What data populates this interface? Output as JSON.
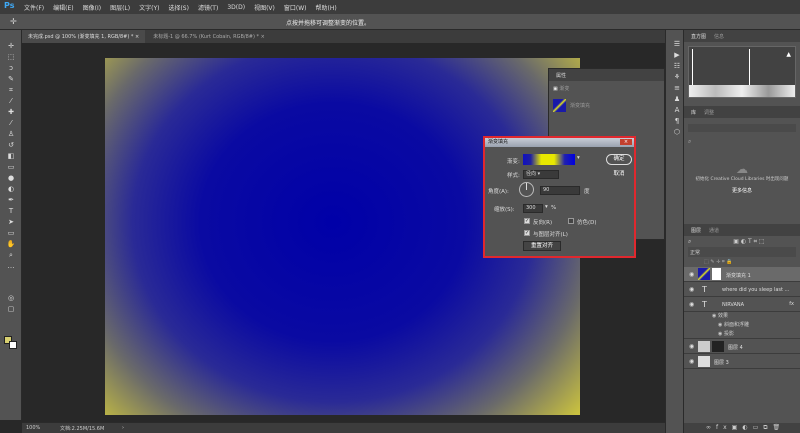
{
  "app": {
    "logo": "Ps",
    "menu": [
      "文件(F)",
      "编辑(E)",
      "图像(I)",
      "图层(L)",
      "文字(Y)",
      "选择(S)",
      "滤镜(T)",
      "3D(D)",
      "视图(V)",
      "窗口(W)",
      "帮助(H)"
    ]
  },
  "options": {
    "hint": "点按并拖移可调整渐变的位置。"
  },
  "tabs": [
    {
      "label": "未完成.psd @ 100% (渐变填充 1, RGB/8#) *",
      "close": "×"
    },
    {
      "label": "未标题-1 @ 66.7% (Kurt Cobain, RGB/8#) *",
      "close": "×"
    }
  ],
  "status": {
    "zoom": "100%",
    "doc": "文档:2.25M/15.6M"
  },
  "histogram": {
    "tabs": [
      "直方图",
      "信息"
    ]
  },
  "libraries": {
    "tabs": [
      "库",
      "调整"
    ],
    "message": "初始化 Creative Cloud Libraries 时出现问题",
    "more": "更多信息"
  },
  "properties": {
    "title": "属性",
    "subtitle": "渐变",
    "layer_label": "渐变填充"
  },
  "dialog": {
    "title": "渐变填充",
    "gradient_label": "渐变:",
    "style_label": "样式:",
    "style_value": "径向",
    "angle_label": "角度(A):",
    "angle_value": "90",
    "angle_unit": "度",
    "scale_label": "缩放(S):",
    "scale_value": "300",
    "scale_unit": "%",
    "reverse_label": "反向(R)",
    "reverse_checked": true,
    "dither_label": "仿色(D)",
    "dither_checked": false,
    "align_label": "与图层对齐(L)",
    "align_checked": true,
    "reset_label": "重置对齐",
    "ok": "确定",
    "cancel": "取消",
    "close": "×"
  },
  "layers": {
    "tabs": [
      "图层",
      "通道"
    ],
    "blend_mode": "正常",
    "items": [
      {
        "name": "渐变填充 1",
        "type": "fill",
        "selected": true
      },
      {
        "name": "where did you sleep last ...",
        "type": "text"
      },
      {
        "name": "NIRVANA",
        "type": "text",
        "fx": "fx"
      },
      {
        "name": "效果",
        "type": "effect"
      },
      {
        "name": "斜面和浮雕",
        "type": "effect"
      },
      {
        "name": "投影",
        "type": "effect"
      },
      {
        "name": "图层 4",
        "type": "pixel"
      },
      {
        "name": "图层 3",
        "type": "pixel"
      }
    ]
  },
  "colors": {
    "gradient_inner": "#0000a8",
    "gradient_outer": "#c8c040",
    "dialog_border": "#e0282e"
  }
}
